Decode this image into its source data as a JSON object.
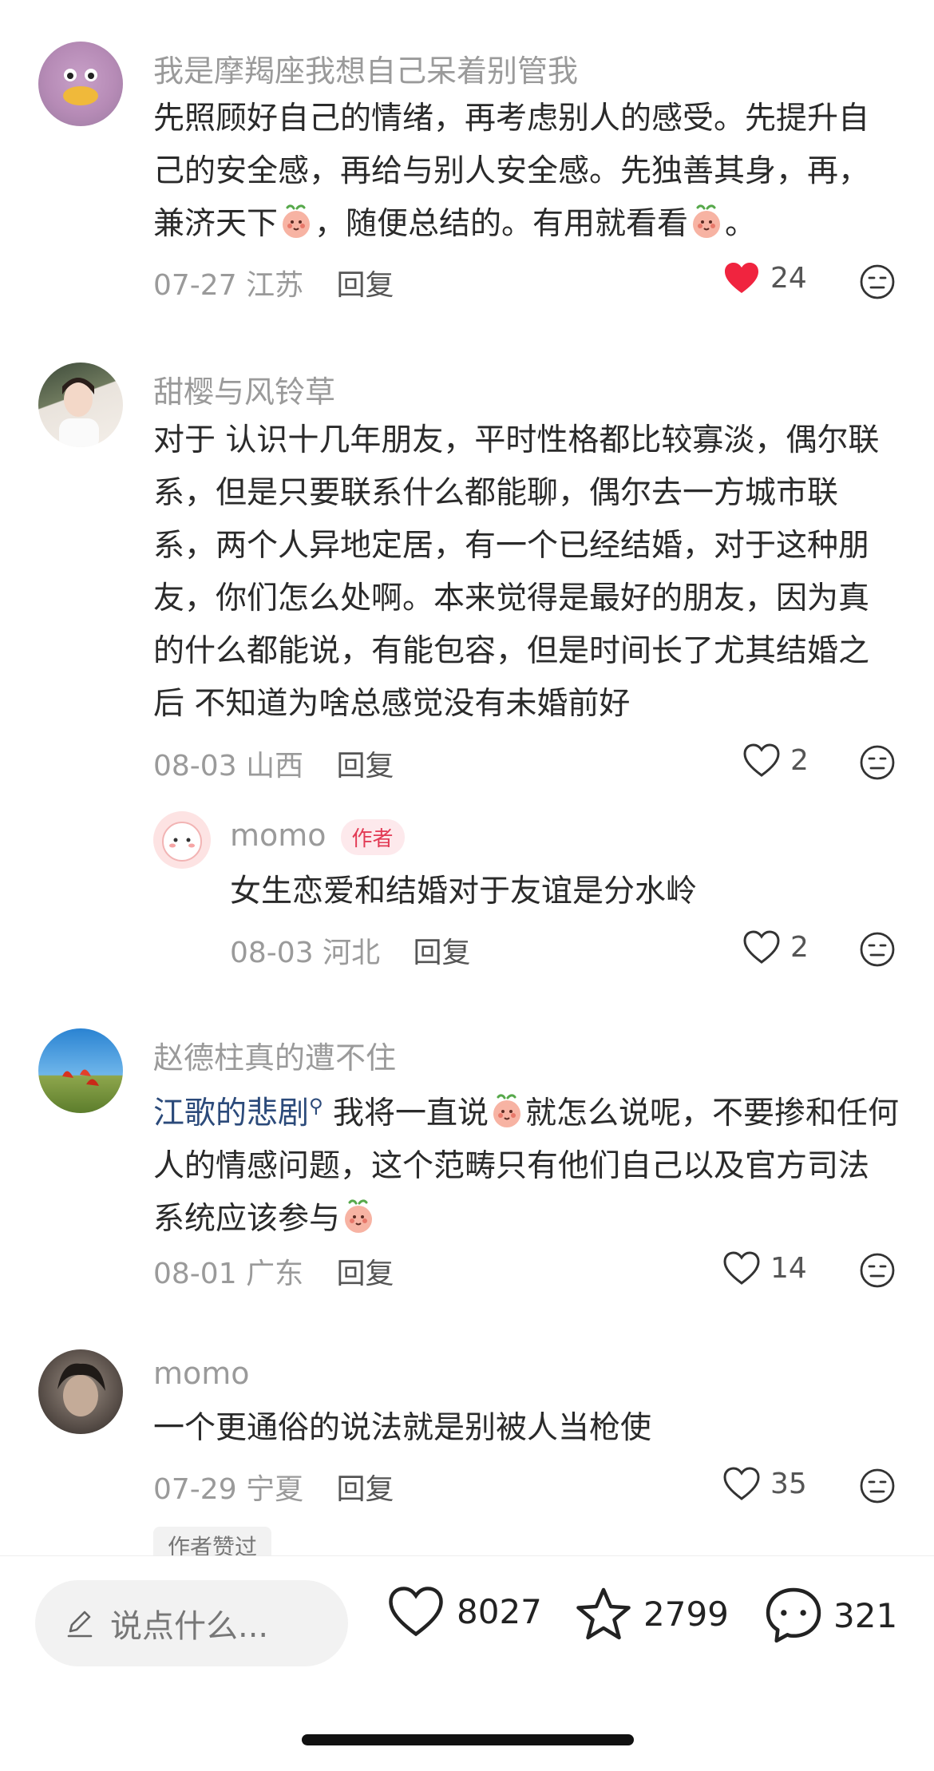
{
  "comments": [
    {
      "username": "我是摩羯座我想自己呆着别管我",
      "text_parts": [
        "先照顾好自己的情绪，再考虑别人的感受。先提升自己的安全感，再给与别人安全感。先独善其身，再，兼济天下",
        "，随便总结的。有用就看看",
        "。"
      ],
      "date": "07-27",
      "location": "江苏",
      "reply_label": "回复",
      "likes": "24"
    },
    {
      "username": "甜樱与风铃草",
      "text": "对于 认识十几年朋友，平时性格都比较寡淡，偶尔联系，但是只要联系什么都能聊，偶尔去一方城市联系，两个人异地定居，有一个已经结婚，对于这种朋友，你们怎么处啊。本来觉得是最好的朋友，因为真的什么都能说，有能包容，但是时间长了尤其结婚之后 不知道为啥总感觉没有未婚前好",
      "date": "08-03",
      "location": "山西",
      "reply_label": "回复",
      "likes": "2",
      "reply": {
        "username": "momo",
        "badge": "作者",
        "text": "女生恋爱和结婚对于友谊是分水岭",
        "date": "08-03",
        "location": "河北",
        "reply_label": "回复",
        "likes": "2"
      }
    },
    {
      "username": "赵德柱真的遭不住",
      "topic": "江歌的悲剧",
      "text_parts": [
        "我将一直说",
        "就怎么说呢，不要掺和任何人的情感问题，这个范畴只有他们自己以及官方司法系统应该参与"
      ],
      "date": "08-01",
      "location": "广东",
      "reply_label": "回复",
      "likes": "14"
    },
    {
      "username": "momo",
      "text": "一个更通俗的说法就是别被人当枪使",
      "date": "07-29",
      "location": "宁夏",
      "reply_label": "回复",
      "likes": "35",
      "tag": "作者赞过"
    }
  ],
  "bottom": {
    "input_placeholder": "说点什么...",
    "likes": "8027",
    "favorites": "2799",
    "comments": "321"
  },
  "colors": {
    "like_active": "#f0243f",
    "badge_bg": "#fde9ec",
    "badge_text": "#e23b55"
  },
  "icons": [
    "pencil-icon",
    "heart-icon",
    "star-icon",
    "chat-bubble-icon",
    "dislike-face-icon",
    "emoji-peach"
  ]
}
